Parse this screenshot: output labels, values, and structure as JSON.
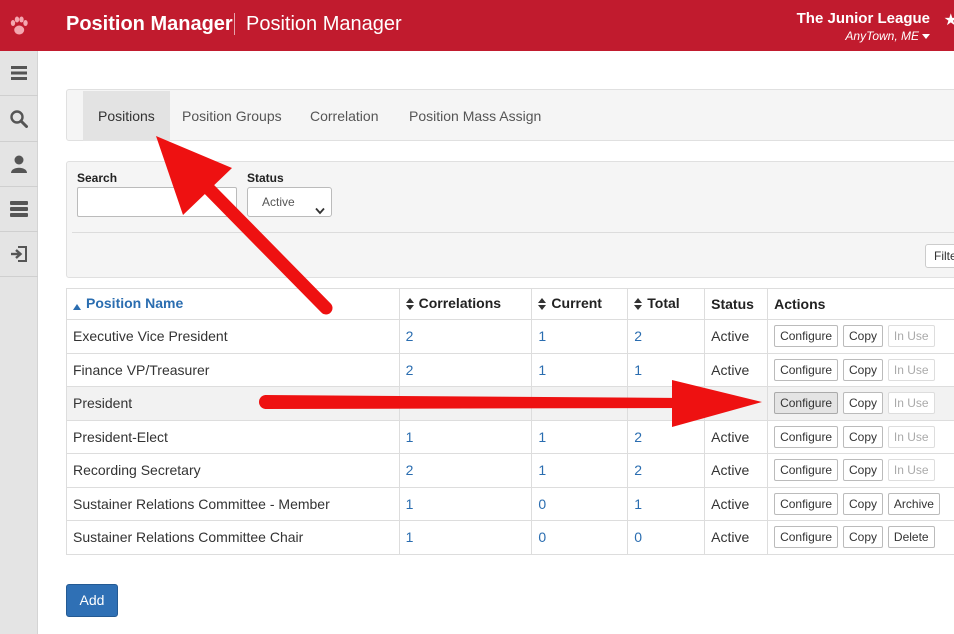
{
  "header": {
    "app_title": "Position Manager",
    "page_title": "Position Manager",
    "org_name": "The Junior League",
    "org_location": "AnyTown, ME",
    "logo_icon": "paw-icon"
  },
  "sidebar": {
    "items": [
      {
        "icon": "menu-icon"
      },
      {
        "icon": "search-icon"
      },
      {
        "icon": "user-icon"
      },
      {
        "icon": "server-icon"
      },
      {
        "icon": "sign-out-icon"
      }
    ]
  },
  "tabs": [
    {
      "label": "Positions",
      "active": true
    },
    {
      "label": "Position Groups",
      "active": false
    },
    {
      "label": "Correlation",
      "active": false
    },
    {
      "label": "Position Mass Assign",
      "active": false
    }
  ],
  "filters": {
    "search_label": "Search",
    "search_value": "",
    "status_label": "Status",
    "status_value": "Active",
    "filter_button": "Filte"
  },
  "table": {
    "columns": [
      "Position Name",
      "Correlations",
      "Current",
      "Total",
      "Status",
      "Actions"
    ],
    "rows": [
      {
        "name": "Executive Vice President",
        "correlations": "2",
        "current": "1",
        "total": "2",
        "status": "Active",
        "actions": [
          "Configure",
          "Copy",
          "In Use"
        ]
      },
      {
        "name": "Finance VP/Treasurer",
        "correlations": "2",
        "current": "1",
        "total": "1",
        "status": "Active",
        "actions": [
          "Configure",
          "Copy",
          "In Use"
        ]
      },
      {
        "name": "President",
        "correlations": "",
        "current": "",
        "total": "",
        "status": "",
        "actions": [
          "Configure",
          "Copy",
          "In Use"
        ]
      },
      {
        "name": "President-Elect",
        "correlations": "1",
        "current": "1",
        "total": "2",
        "status": "Active",
        "actions": [
          "Configure",
          "Copy",
          "In Use"
        ]
      },
      {
        "name": "Recording Secretary",
        "correlations": "2",
        "current": "1",
        "total": "2",
        "status": "Active",
        "actions": [
          "Configure",
          "Copy",
          "In Use"
        ]
      },
      {
        "name": "Sustainer Relations Committee - Member",
        "correlations": "1",
        "current": "0",
        "total": "1",
        "status": "Active",
        "actions": [
          "Configure",
          "Copy",
          "Archive"
        ]
      },
      {
        "name": "Sustainer Relations Committee Chair",
        "correlations": "1",
        "current": "0",
        "total": "0",
        "status": "Active",
        "actions": [
          "Configure",
          "Copy",
          "Delete"
        ]
      }
    ]
  },
  "add_button": "Add",
  "colors": {
    "header_bg": "#c11b2e",
    "link": "#2a6db0",
    "primary_button": "#2f70b5",
    "annotation_arrow": "#ee1111"
  }
}
